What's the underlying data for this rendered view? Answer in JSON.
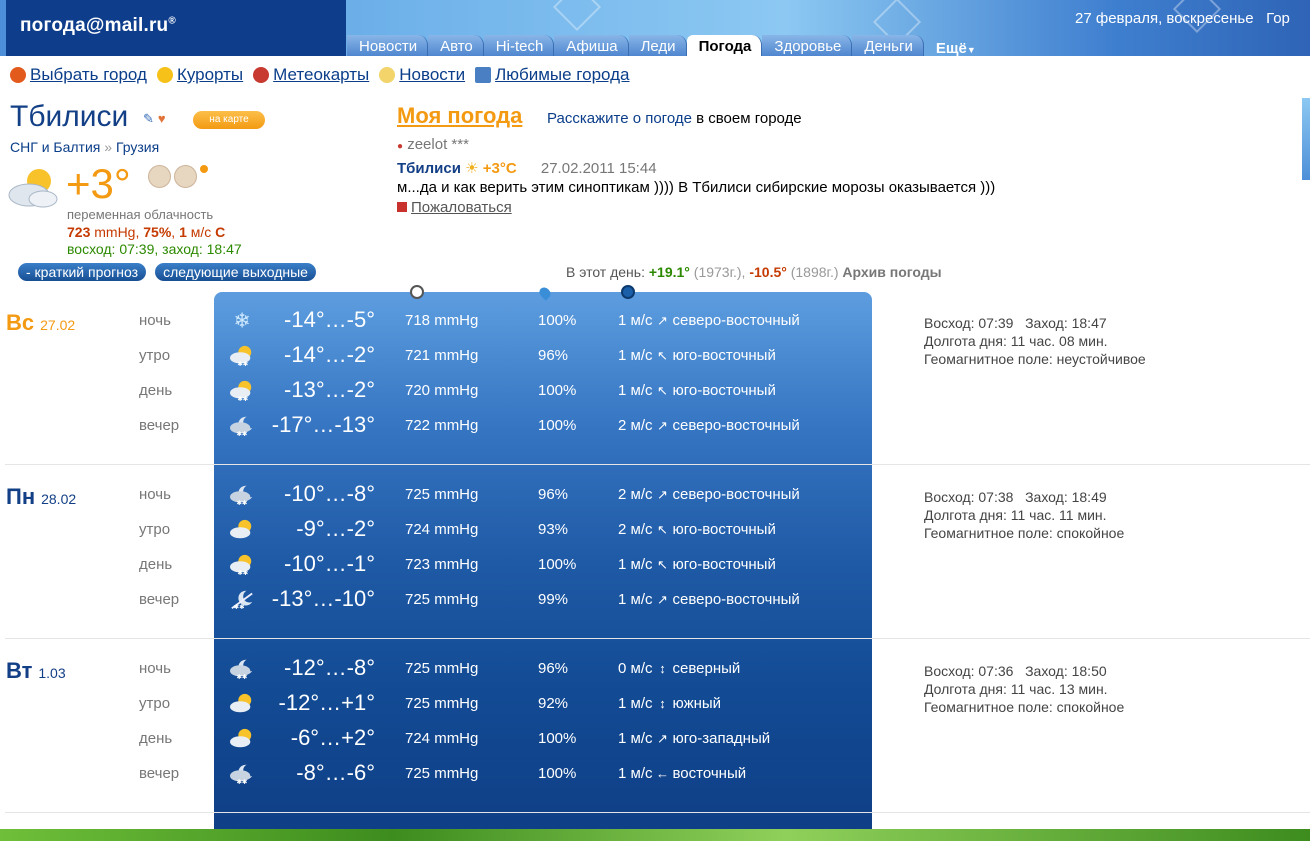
{
  "header": {
    "logo": "погода@mail.ru",
    "logo_mark": "®",
    "date": "27 февраля, воскресенье",
    "extra": "Гор",
    "tabs": [
      "Новости",
      "Авто",
      "Hi-tech",
      "Афиша",
      "Леди",
      "Погода",
      "Здоровье",
      "Деньги"
    ],
    "active_tab": "Погода",
    "more": "Ещё"
  },
  "nav": {
    "items": [
      {
        "label": "Выбрать город",
        "icon": "compass-icon"
      },
      {
        "label": "Курорты",
        "icon": "sun-icon"
      },
      {
        "label": "Метеокарты",
        "icon": "map-icon"
      },
      {
        "label": "Новости",
        "icon": "news-icon"
      },
      {
        "label": "Любимые города",
        "icon": "city-icon"
      }
    ]
  },
  "city": {
    "name": "Тбилиси",
    "map_button": "на карте",
    "breadcrumb": [
      "СНГ и Балтия",
      "Грузия"
    ],
    "breadcrumb_sep": "»",
    "temp": "+3°",
    "description": "переменная облачность",
    "pressure": "723",
    "pressure_unit": "mmHg,",
    "humidity": "75%",
    "wind_speed": "1",
    "wind_unit": "м/с",
    "wind_dir": "С",
    "sun": "восход: 07:39, заход: 18:47",
    "btn_short": "- краткий прогноз",
    "btn_weekend": "следующие выходные"
  },
  "my_weather": {
    "title": "Моя погода",
    "tell_link": "Расскажите о погоде",
    "tell_rest": " в своем городе",
    "user": "zeelot ***",
    "post_city": "Тбилиси",
    "post_temp": "+3°C",
    "post_date": "27.02.2011 15:44",
    "post_text": "м...да и как верить этим синоптикам )))) В Тбилиси сибирские морозы оказывается )))",
    "complain": "Пожаловаться"
  },
  "this_day": {
    "label": "В этот день:",
    "max": "+19.1°",
    "max_year": "(1973г.),",
    "min": "-10.5°",
    "min_year": "(1898г.)",
    "archive": "Архив погоды"
  },
  "colors": {
    "accent_orange": "#f39a12",
    "link_blue": "#0b3e8a",
    "panel_blue": "#1f5aa6",
    "sunday_color": "#f39a12",
    "weekday_color": "#123f86"
  },
  "forecast": [
    {
      "day": "Вс",
      "date": "27.02",
      "sun": "Восход: 07:39   Заход: 18:47",
      "daylength": "Долгота дня: 11 час. 08 мин.",
      "geomag": "Геомагнитное поле: неустойчивое",
      "rows": [
        {
          "period": "ночь",
          "icon": "snowflake-icon",
          "temp": "-14°…-5°",
          "press": "718 mmHg",
          "hum": "100%",
          "wind": "1 м/с",
          "arrow": "↗",
          "dir": "северо-восточный"
        },
        {
          "period": "утро",
          "icon": "sun-cloud-snow-icon",
          "temp": "-14°…-2°",
          "press": "721 mmHg",
          "hum": "96%",
          "wind": "1 м/с",
          "arrow": "↖",
          "dir": "юго-восточный"
        },
        {
          "period": "день",
          "icon": "sun-cloud-snow-icon",
          "temp": "-13°…-2°",
          "press": "720 mmHg",
          "hum": "100%",
          "wind": "1 м/с",
          "arrow": "↖",
          "dir": "юго-восточный"
        },
        {
          "period": "вечер",
          "icon": "moon-cloud-snow-icon",
          "temp": "-17°…-13°",
          "press": "722 mmHg",
          "hum": "100%",
          "wind": "2 м/с",
          "arrow": "↗",
          "dir": "северо-восточный"
        }
      ]
    },
    {
      "day": "Пн",
      "date": "28.02",
      "sun": "Восход: 07:38   Заход: 18:49",
      "daylength": "Долгота дня: 11 час. 11 мин.",
      "geomag": "Геомагнитное поле: спокойное",
      "rows": [
        {
          "period": "ночь",
          "icon": "moon-cloud-snow-icon",
          "temp": "-10°…-8°",
          "press": "725 mmHg",
          "hum": "96%",
          "wind": "2 м/с",
          "arrow": "↗",
          "dir": "северо-восточный"
        },
        {
          "period": "утро",
          "icon": "sun-cloud-icon",
          "temp": "-9°…-2°",
          "press": "724 mmHg",
          "hum": "93%",
          "wind": "2 м/с",
          "arrow": "↖",
          "dir": "юго-восточный"
        },
        {
          "period": "день",
          "icon": "sun-cloud-snow-icon",
          "temp": "-10°…-1°",
          "press": "723 mmHg",
          "hum": "100%",
          "wind": "1 м/с",
          "arrow": "↖",
          "dir": "юго-восточный"
        },
        {
          "period": "вечер",
          "icon": "moon-snow-icon",
          "temp": "-13°…-10°",
          "press": "725 mmHg",
          "hum": "99%",
          "wind": "1 м/с",
          "arrow": "↗",
          "dir": "северо-восточный"
        }
      ]
    },
    {
      "day": "Вт",
      "date": "1.03",
      "sun": "Восход: 07:36   Заход: 18:50",
      "daylength": "Долгота дня: 11 час. 13 мин.",
      "geomag": "Геомагнитное поле: спокойное",
      "rows": [
        {
          "period": "ночь",
          "icon": "moon-cloud-snow-icon",
          "temp": "-12°…-8°",
          "press": "725 mmHg",
          "hum": "96%",
          "wind": "0 м/с",
          "arrow": "↕",
          "dir": "северный"
        },
        {
          "period": "утро",
          "icon": "sun-cloud-icon",
          "temp": "-12°…+1°",
          "press": "725 mmHg",
          "hum": "92%",
          "wind": "1 м/с",
          "arrow": "↕",
          "dir": "южный"
        },
        {
          "period": "день",
          "icon": "sun-cloud-icon",
          "temp": "-6°…+2°",
          "press": "724 mmHg",
          "hum": "100%",
          "wind": "1 м/с",
          "arrow": "↗",
          "dir": "юго-западный"
        },
        {
          "period": "вечер",
          "icon": "moon-cloud-snow-icon",
          "temp": "-8°…-6°",
          "press": "725 mmHg",
          "hum": "100%",
          "wind": "1 м/с",
          "arrow": "←",
          "dir": "восточный"
        }
      ]
    }
  ]
}
